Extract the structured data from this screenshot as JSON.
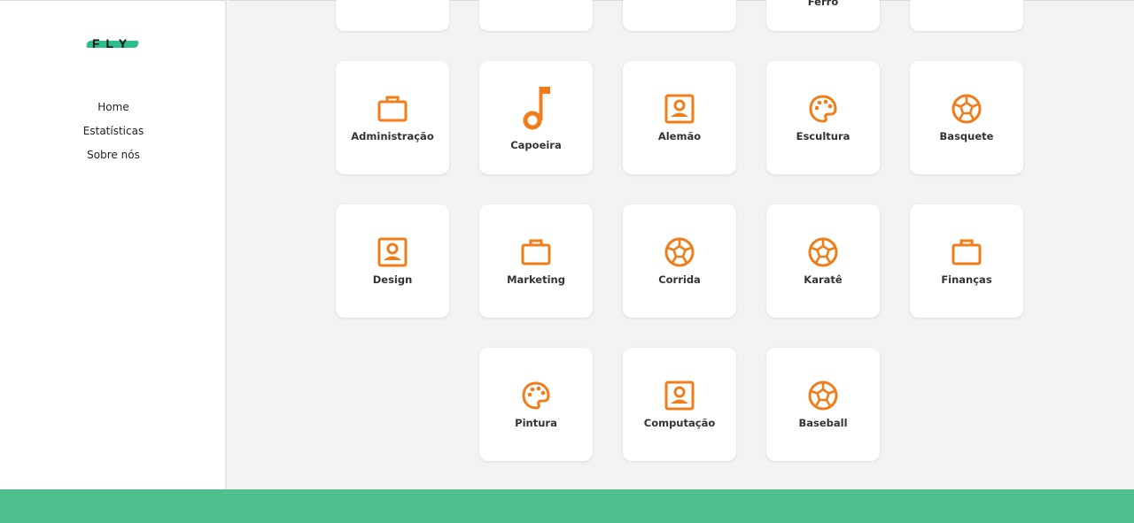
{
  "brand": {
    "logo_text": "FLY"
  },
  "nav": {
    "items": [
      {
        "label": "Home"
      },
      {
        "label": "Estatísticas"
      },
      {
        "label": "Sobre nós"
      }
    ]
  },
  "colors": {
    "accent": "#f07d1a",
    "footer": "#4fc08d",
    "brand_swash": "#2ebc8a"
  },
  "top_row_partial": {
    "visible_label_fragment": "Ferro"
  },
  "cards": [
    {
      "label": "Administração",
      "icon": "briefcase-icon"
    },
    {
      "label": "Capoeira",
      "icon": "music-note-icon"
    },
    {
      "label": "Alemão",
      "icon": "portrait-icon"
    },
    {
      "label": "Escultura",
      "icon": "palette-icon"
    },
    {
      "label": "Basquete",
      "icon": "soccer-ball-icon"
    },
    {
      "label": "Design",
      "icon": "portrait-icon"
    },
    {
      "label": "Marketing",
      "icon": "briefcase-icon"
    },
    {
      "label": "Corrida",
      "icon": "soccer-ball-icon"
    },
    {
      "label": "Karatê",
      "icon": "soccer-ball-icon"
    },
    {
      "label": "Finanças",
      "icon": "briefcase-icon"
    },
    {
      "label": "Pintura",
      "icon": "palette-icon"
    },
    {
      "label": "Computação",
      "icon": "portrait-icon"
    },
    {
      "label": "Baseball",
      "icon": "soccer-ball-icon"
    }
  ]
}
